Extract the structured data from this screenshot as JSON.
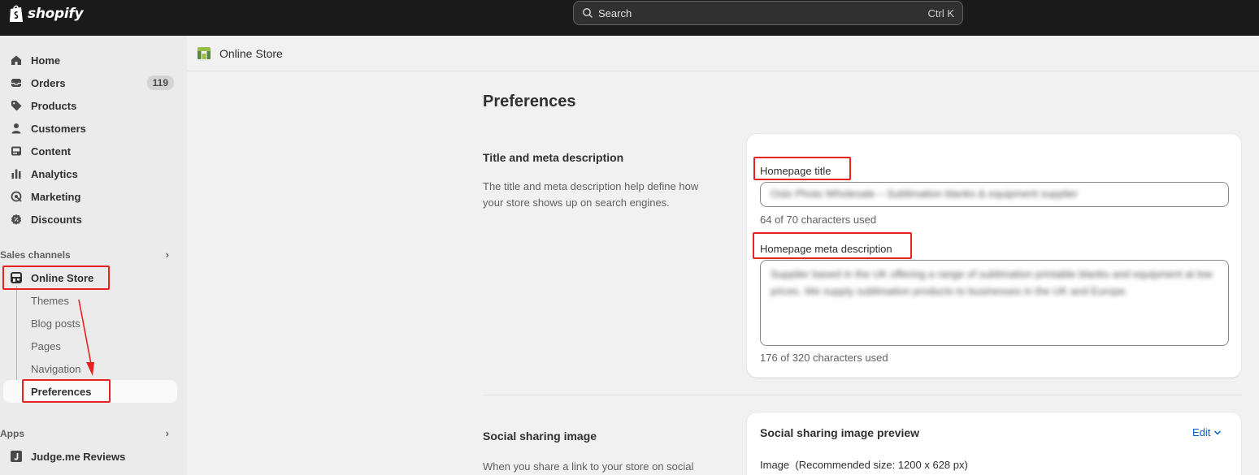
{
  "topbar": {
    "brand": "shopify",
    "search_placeholder": "Search",
    "search_shortcut": "Ctrl K"
  },
  "sidebar": {
    "items": [
      {
        "label": "Home",
        "icon": "home-icon"
      },
      {
        "label": "Orders",
        "icon": "inbox-icon",
        "badge": "119"
      },
      {
        "label": "Products",
        "icon": "tag-icon"
      },
      {
        "label": "Customers",
        "icon": "person-icon"
      },
      {
        "label": "Content",
        "icon": "image-icon"
      },
      {
        "label": "Analytics",
        "icon": "bar-chart-icon"
      },
      {
        "label": "Marketing",
        "icon": "target-icon"
      },
      {
        "label": "Discounts",
        "icon": "discount-icon"
      }
    ],
    "sales_channels_label": "Sales channels",
    "online_store_label": "Online Store",
    "sub_items": [
      "Themes",
      "Blog posts",
      "Pages",
      "Navigation",
      "Preferences"
    ],
    "apps_label": "Apps",
    "app_item_label": "Judge.me Reviews"
  },
  "header": {
    "title": "Online Store"
  },
  "main": {
    "page_title": "Preferences",
    "title_meta_section": {
      "heading": "Title and meta description",
      "description": "The title and meta description help define how your store shows up on search engines.",
      "homepage_title_label": "Homepage title",
      "homepage_title_value": "Oslo Photo Wholesale – Sublimation blanks & equipment supplier",
      "homepage_title_help": "64 of 70 characters used",
      "meta_description_label": "Homepage meta description",
      "meta_description_value": "Supplier based in the UK offering a range of sublimation printable blanks and equipment at low prices. We supply sublimation products to businesses in the UK and Europe.",
      "meta_description_help": "176 of 320 characters used"
    },
    "social_section": {
      "heading": "Social sharing image",
      "description": "When you share a link to your store on social",
      "card_title": "Social sharing image preview",
      "edit_label": "Edit",
      "image_label": "Image",
      "image_recommendation": "(Recommended size: 1200 x 628 px)"
    }
  },
  "colors": {
    "topbar_bg": "#1a1a1a",
    "sidebar_bg": "#ebebeb",
    "annotation_red": "#e8231f",
    "link_blue": "#005bd3"
  }
}
